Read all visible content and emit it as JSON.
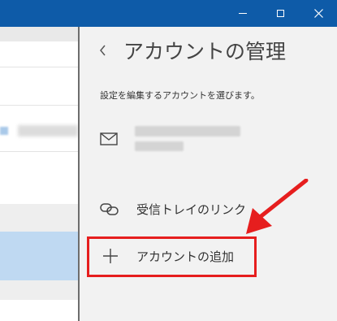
{
  "window": {
    "controls": [
      "minimize-icon",
      "maximize-icon",
      "close-icon"
    ],
    "titlebar_color": "#0e5ba8"
  },
  "panel": {
    "back_icon": "chevron-left-icon",
    "title": "アカウントの管理",
    "subtitle": "設定を編集するアカウントを選びます。",
    "account": {
      "icon": "mail-icon"
    },
    "link_inboxes": {
      "icon": "link-icon",
      "label": "受信トレイのリンク"
    },
    "add_account": {
      "icon": "plus-icon",
      "label": "アカウントの追加"
    }
  },
  "annotation": {
    "highlight_color": "#e61e1e"
  }
}
